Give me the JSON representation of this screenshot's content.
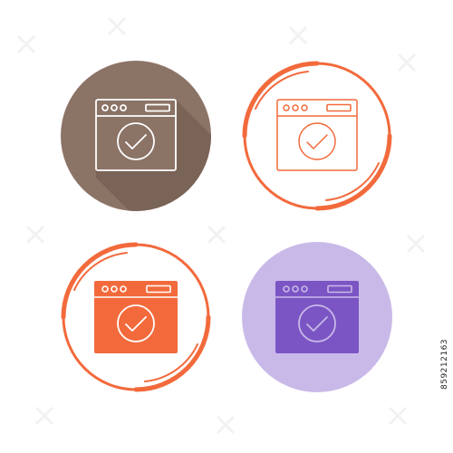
{
  "stock_id": "859212163",
  "icons": [
    {
      "name": "browser-check-icon-brown-flat",
      "style": "flat-long-shadow",
      "circle": "#8b7366",
      "shadow": "#7a6357",
      "stroke": "#ffffff"
    },
    {
      "name": "browser-check-icon-outline-ring",
      "style": "outline-ring",
      "ring": "#f26a3c",
      "stroke": "#f26a3c"
    },
    {
      "name": "browser-check-icon-filled-ring",
      "style": "filled-ring",
      "ring": "#f26a3c",
      "fill": "#f26a3c",
      "stroke": "#ffffff"
    },
    {
      "name": "browser-check-icon-purple-flat",
      "style": "flat-circle",
      "circle": "#c9b9e8",
      "fill": "#7b55c4",
      "stroke": "#c9b9e8"
    }
  ],
  "watermark": {
    "color": "#f1f1f1"
  }
}
